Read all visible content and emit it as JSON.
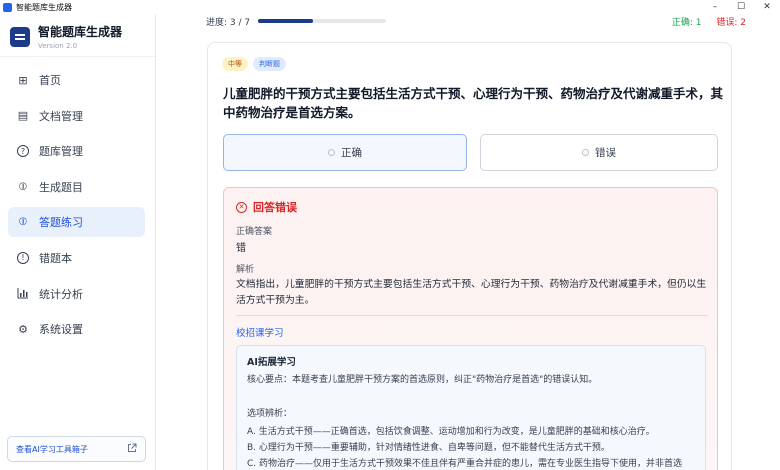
{
  "window": {
    "title": "智能题库生成器",
    "controls": {
      "minimize": "–",
      "maximize": "☐",
      "close": "✕"
    }
  },
  "sidebar": {
    "brand_title": "智能题库生成器",
    "brand_version": "Version 2.0",
    "items": [
      {
        "label": "首页",
        "icon": "grid-icon",
        "glyph": "⊞",
        "active": false
      },
      {
        "label": "文档管理",
        "icon": "document-icon",
        "glyph": "▤",
        "active": false
      },
      {
        "label": "题库管理",
        "icon": "help-circle-icon",
        "glyph": "?",
        "active": false
      },
      {
        "label": "生成题目",
        "icon": "generate-icon",
        "glyph": "⦶",
        "active": false
      },
      {
        "label": "答题练习",
        "icon": "practice-icon",
        "glyph": "⦶",
        "active": true
      },
      {
        "label": "错题本",
        "icon": "alert-circle-icon",
        "glyph": "!",
        "active": false
      },
      {
        "label": "统计分析",
        "icon": "bar-chart-icon",
        "glyph": "┃",
        "active": false
      },
      {
        "label": "系统设置",
        "icon": "gear-icon",
        "glyph": "⚙",
        "active": false
      }
    ],
    "footer_text": "查看AI学习工具箱子",
    "footer_icon": "external-link-icon"
  },
  "progress": {
    "label": "进度: 3 / 7",
    "fraction": 0.43,
    "correct_label": "正确: 1",
    "wrong_label": "错误: 2"
  },
  "question": {
    "difficulty_tag": "中等",
    "type_tag": "判断题",
    "text": "儿童肥胖的干预方式主要包括生活方式干预、心理行为干预、药物治疗及代谢减重手术，其中药物治疗是首选方案。",
    "options": [
      {
        "label": "正确",
        "selected": true
      },
      {
        "label": "错误",
        "selected": false
      }
    ]
  },
  "result": {
    "heading": "回答错误",
    "answer_label": "正确答案",
    "answer_value": "错",
    "explain_label": "解析",
    "explain_text": "文档指出，儿童肥胖的干预方式主要包括生活方式干预、心理行为干预、药物治疗及代谢减重手术，但仍以生活方式干预为主。",
    "learn_link": "校招课学习",
    "ai": {
      "title": "AI拓展学习",
      "core": "核心要点：本题考查儿童肥胖干预方案的首选原则，纠正\"药物治疗是首选\"的错误认知。",
      "section": "选项辨析：",
      "line_a": "A. 生活方式干预——正确首选，包括饮食调整、运动增加和行为改变，是儿童肥胖的基础和核心治疗。",
      "line_b": "B. 心理行为干预——重要辅助，针对情绪性进食、自卑等问题，但不能替代生活方式干预。",
      "line_c": "C. 药物治疗——仅用于生活方式干预效果不佳且伴有严重合并症的患儿，需在专业医生指导下使用，并非首选"
    }
  },
  "colors": {
    "accent": "#1d4ed8",
    "active_bg": "#e8f0fb",
    "error": "#dc2626",
    "success": "#16a34a"
  }
}
